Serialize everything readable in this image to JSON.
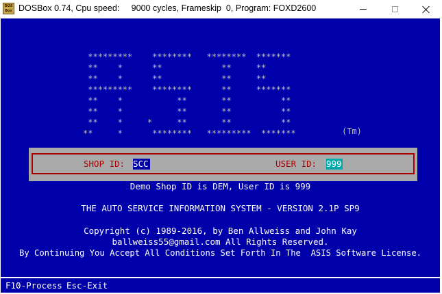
{
  "window": {
    "icon_text": "DOS\nBox",
    "title": "DOSBox 0.74, Cpu speed:     9000 cycles, Frameskip  0, Program: FOXD2600"
  },
  "screen": {
    "logo_lines": [
      " *********    ********   ********  *******",
      " **    *      **            **     **",
      " **    *      **            **     **",
      " *********    ********      **     *******",
      " **    *           **       **          **",
      " **    *           **       **          **",
      " **    *     *     **       **          **",
      "**     *      ********   *********  *******"
    ],
    "trademark": "(Tm)",
    "login": {
      "shop_label": "SHOP ID:",
      "shop_value": "SCC",
      "user_label": "USER ID:",
      "user_value": "999"
    },
    "demo_text": "Demo Shop ID is DEM, User ID is 999",
    "version_text": "THE AUTO SERVICE INFORMATION SYSTEM - VERSION 2.1P SP9",
    "copyright_text": "Copyright (c) 1989-2016, by Ben Allweiss and John Kay",
    "email_text": "ballweiss55@gmail.com All Rights Reserved.",
    "license_text": "By Continuing You Accept All Conditions Set Forth In The  ASIS Software License.",
    "status_bar": {
      "f10_label": "F10-Process",
      "esc_label": "Esc-Exit"
    }
  },
  "colors": {
    "dos_blue": "#0000aa",
    "dos_gray": "#aaaaaa",
    "dos_red": "#aa0000",
    "dos_cyan": "#00aaaa",
    "dos_white": "#ffffff"
  },
  "icons": {
    "app": "dosbox-icon",
    "minimize": "minimize-icon",
    "maximize": "maximize-icon",
    "close": "close-icon"
  }
}
